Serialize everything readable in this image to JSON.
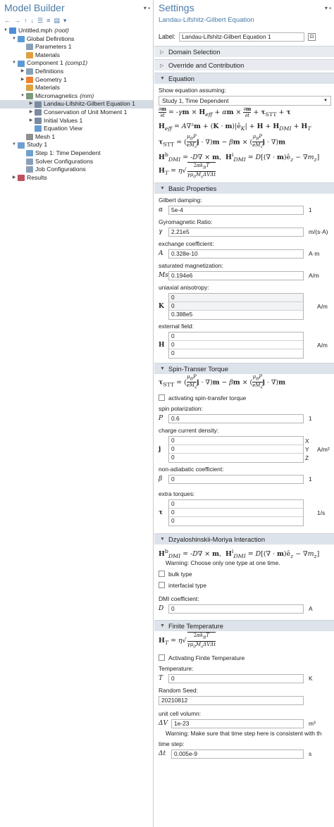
{
  "model_builder": {
    "title": "Model Builder",
    "tree": [
      {
        "label": "Untitled.mph",
        "tag": "(root)",
        "level": 0,
        "expanded": "open",
        "icon": "#4d8fd6"
      },
      {
        "label": "Global Definitions",
        "level": 1,
        "expanded": "open",
        "icon": "#5b9bd5"
      },
      {
        "label": "Parameters 1",
        "level": 2,
        "expanded": "",
        "icon": "#8aa0b8"
      },
      {
        "label": "Materials",
        "level": 2,
        "expanded": "",
        "icon": "#e0a040"
      },
      {
        "label": "Component 1",
        "tag": "(comp1)",
        "level": 1,
        "expanded": "open",
        "icon": "#5b9bd5"
      },
      {
        "label": "Definitions",
        "level": 2,
        "expanded": "closed",
        "icon": "#8aa0b8"
      },
      {
        "label": "Geometry 1",
        "level": 2,
        "expanded": "closed",
        "icon": "#f08030"
      },
      {
        "label": "Materials",
        "level": 2,
        "expanded": "",
        "icon": "#e0a040"
      },
      {
        "label": "Micromagnetics",
        "tag": "(mm)",
        "level": 2,
        "expanded": "open",
        "icon": "#7a9a7a"
      },
      {
        "label": "Landau-Lifshitz-Gilbert Equation 1",
        "level": 3,
        "expanded": "closed",
        "icon": "#7a8aa0",
        "selected": true
      },
      {
        "label": "Conservation of Unit Moment 1",
        "level": 3,
        "expanded": "closed",
        "icon": "#7a8aa0"
      },
      {
        "label": "Initial Values 1",
        "level": 3,
        "expanded": "closed",
        "icon": "#7a8aa0"
      },
      {
        "label": "Equation View",
        "level": 3,
        "expanded": "",
        "icon": "#6a9ad0"
      },
      {
        "label": "Mesh 1",
        "level": 2,
        "expanded": "",
        "icon": "#909090"
      },
      {
        "label": "Study 1",
        "level": 1,
        "expanded": "open",
        "icon": "#70a0d0"
      },
      {
        "label": "Step 1: Time Dependent",
        "level": 2,
        "expanded": "",
        "icon": "#70a0d0"
      },
      {
        "label": "Solver Configurations",
        "level": 2,
        "expanded": "",
        "icon": "#8aa0b8"
      },
      {
        "label": "Job Configurations",
        "level": 2,
        "expanded": "",
        "icon": "#8aa0b8"
      },
      {
        "label": "Results",
        "level": 1,
        "expanded": "closed",
        "icon": "#c05060"
      }
    ]
  },
  "settings": {
    "title": "Settings",
    "subtitle": "Landau-Lifshitz-Gilbert Equation",
    "label_caption": "Label:",
    "label_value": "Landau-Lifshitz-Gilbert Equation 1",
    "sections": {
      "domain": "Domain Selection",
      "override": "Override and Contribution",
      "equation": "Equation",
      "basic": "Basic Properties",
      "stt": "Spin-Transer Torque",
      "dmi": "Dzyaloshinskii-Moriya Interaction",
      "finite": "Finite Temperature"
    },
    "equation": {
      "show_caption": "Show equation assuming:",
      "study": "Study 1, Time Dependent"
    },
    "basic": {
      "gilbert_label": "Gilbert damping:",
      "gilbert_sym": "α",
      "gilbert_val": "5e-4",
      "gilbert_unit": "1",
      "gyro_label": "Gyromagnetic Ratio:",
      "gyro_sym": "γ",
      "gyro_val": "2.21e5",
      "gyro_unit": "m/(s·A)",
      "exch_label": "exchange coefficient:",
      "exch_sym": "A",
      "exch_val": "0.328e-10",
      "exch_unit": "A·m",
      "ms_label": "saturated magnetization:",
      "ms_sym": "Ms",
      "ms_val": "0.194e6",
      "ms_unit": "A/m",
      "aniso_label": "uniaxial anisotropy:",
      "aniso_sym": "K",
      "aniso_vals": [
        "0",
        "0",
        "0.388e5"
      ],
      "aniso_unit": "A/m",
      "field_label": "external field:",
      "field_sym": "H",
      "field_vals": [
        "0",
        "0",
        "0"
      ],
      "field_unit": "A/m"
    },
    "stt": {
      "activate": "activating spin-transfer torque",
      "pol_label": "spin polarization:",
      "pol_sym": "P",
      "pol_val": "0.6",
      "pol_unit": "1",
      "j_label": "charge current density:",
      "j_sym": "j",
      "j_vals": [
        "0",
        "0",
        "0"
      ],
      "j_axes": [
        "X",
        "Y",
        "Z"
      ],
      "j_unit": "A/m²",
      "beta_label": "non-adiabatic coefficient:",
      "beta_sym": "β",
      "beta_val": "0",
      "beta_unit": "1",
      "extra_label": "extra torques:",
      "extra_sym": "τ",
      "extra_vals": [
        "0",
        "0",
        "0"
      ],
      "extra_unit": "1/s"
    },
    "dmi": {
      "warning": "Warning: Choose only one type at one time.",
      "bulk": "bulk type",
      "interfacial": "interfacial type",
      "coef_label": "DMI coefficient:",
      "coef_sym": "D",
      "coef_val": "0",
      "coef_unit": "A"
    },
    "finite": {
      "activate": "Activating Finite Temperature",
      "temp_label": "Temperature:",
      "temp_sym": "T",
      "temp_val": "0",
      "temp_unit": "K",
      "seed_label": "Random Seed:",
      "seed_val": "20210812",
      "vol_label": "unit cell volumn:",
      "vol_sym": "ΔV",
      "vol_val": "1e-23",
      "vol_unit": "m³",
      "warning": "Warning: Make sure that time step here is consistent with th",
      "dt_label": "time step:",
      "dt_sym": "Δt",
      "dt_val": "0.005e-9",
      "dt_unit": "s"
    }
  }
}
